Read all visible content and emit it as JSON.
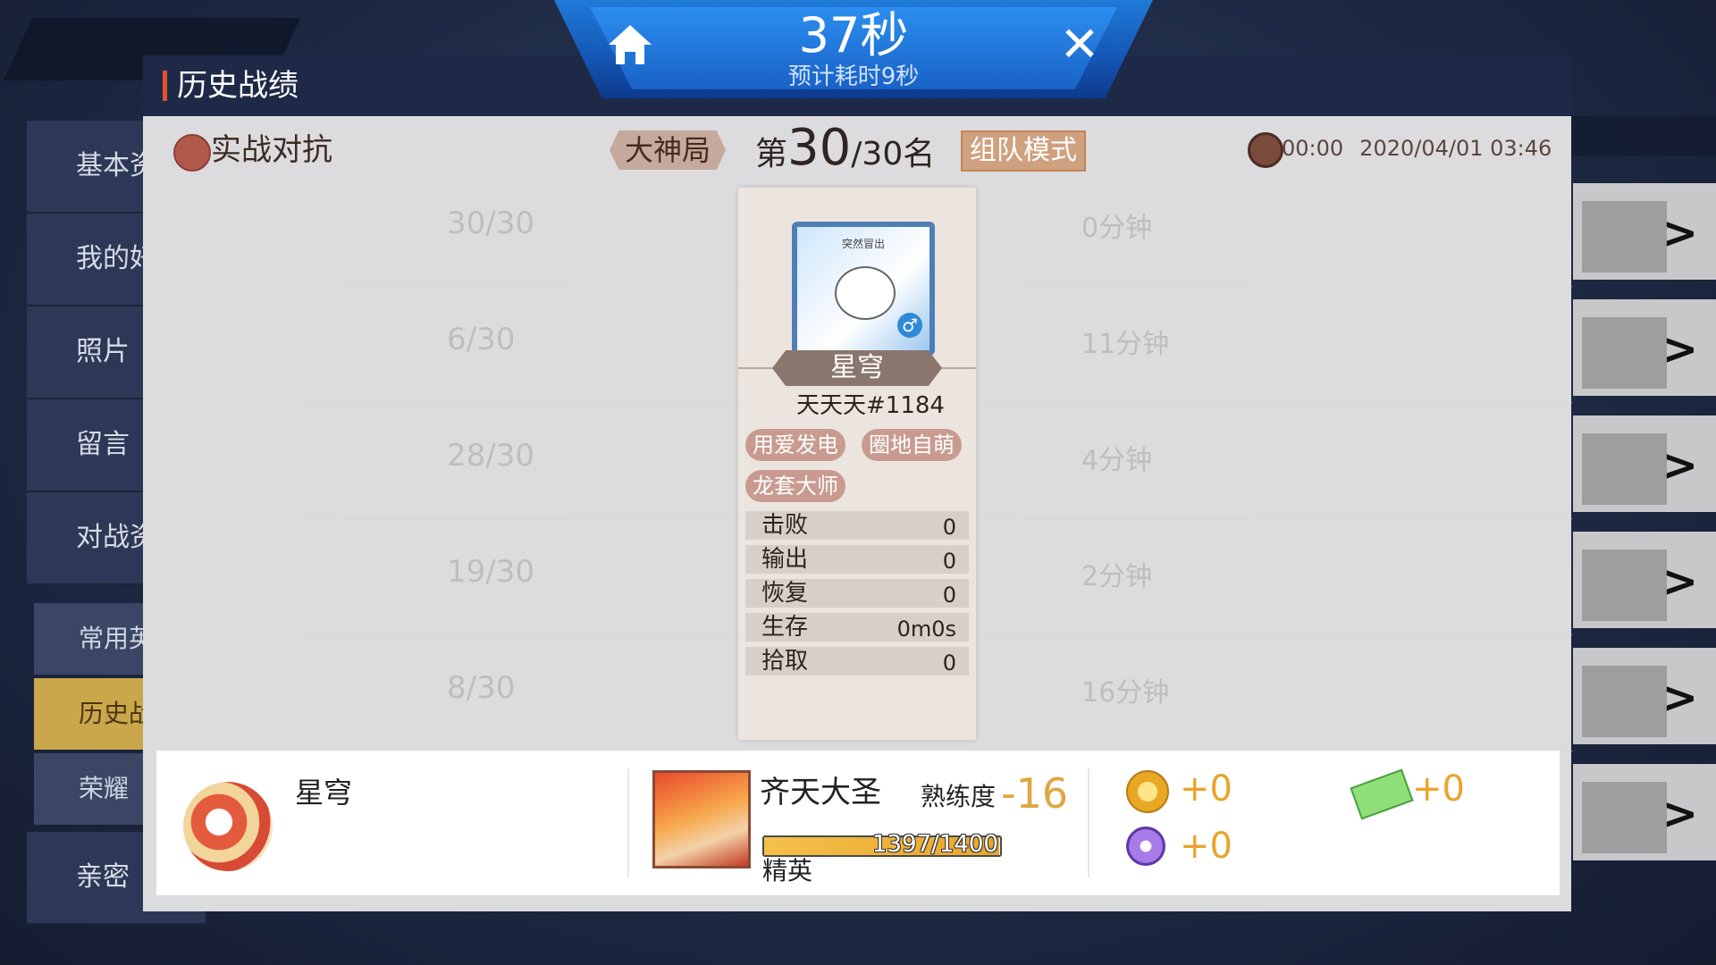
{
  "side_menu": {
    "items": [
      "基本资料",
      "我的好友",
      "照片",
      "留言",
      "对战资料"
    ],
    "sub_items": [
      "常用英雄",
      "历史战绩",
      "荣耀"
    ],
    "last_item": "亲密"
  },
  "dialog": {
    "title": "历史战绩"
  },
  "timer": {
    "seconds": "37秒",
    "estimate": "预计耗时9秒"
  },
  "match": {
    "mode": "实战对抗",
    "tier": "大神局",
    "rank_prefix": "第",
    "rank": "30",
    "rank_suffix": "/30名",
    "team_mode": "组队模式",
    "duration": "00:00",
    "datetime": "2020/04/01 03:46"
  },
  "ghost_rows": [
    {
      "rank": "30/30",
      "dur": "0分钟"
    },
    {
      "rank": "6/30",
      "dur": "11分钟"
    },
    {
      "rank": "28/30",
      "dur": "4分钟"
    },
    {
      "rank": "19/30",
      "dur": "2分钟"
    },
    {
      "rank": "8/30",
      "dur": "16分钟"
    }
  ],
  "player": {
    "avatar_caption": "突然冒出",
    "name": "星穹",
    "id": "天天天#1184",
    "tags": [
      "用爱发电",
      "圈地自萌",
      "龙套大师"
    ],
    "stats": [
      {
        "label": "击败",
        "value": "0"
      },
      {
        "label": "输出",
        "value": "0"
      },
      {
        "label": "恢复",
        "value": "0"
      },
      {
        "label": "生存",
        "value": "0m0s"
      },
      {
        "label": "拾取",
        "value": "0"
      }
    ]
  },
  "result": {
    "player_name": "星穹",
    "hero_name": "齐天大圣",
    "proficiency_label": "熟练度",
    "proficiency_delta": "-16",
    "xp_text": "1397/1400",
    "xp_progress": 0.998,
    "rank_title": "精英",
    "gold_reward": "+0",
    "purple_reward": "+0",
    "gem_reward": "+0"
  },
  "colors": {
    "accent_orange": "#e8a52c",
    "dialog_header": "#1e2947",
    "banner_blue": "#1a62c6"
  }
}
